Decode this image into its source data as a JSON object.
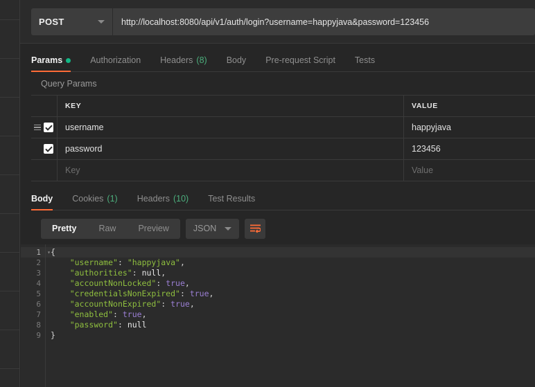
{
  "request": {
    "method": "POST",
    "method_caret_icon": "chevron-down-icon",
    "url": "http://localhost:8080/api/v1/auth/login?username=happyjava&password=123456",
    "tabs": [
      {
        "label": "Params",
        "active": true,
        "badge_dot": true
      },
      {
        "label": "Authorization",
        "active": false
      },
      {
        "label": "Headers",
        "active": false,
        "count": "(8)"
      },
      {
        "label": "Body",
        "active": false
      },
      {
        "label": "Pre-request Script",
        "active": false
      },
      {
        "label": "Tests",
        "active": false
      }
    ]
  },
  "params": {
    "section_label": "Query Params",
    "columns": {
      "key": "KEY",
      "value": "VALUE"
    },
    "rows": [
      {
        "checked": true,
        "drag_handle": true,
        "key": "username",
        "value": "happyjava"
      },
      {
        "checked": true,
        "drag_handle": false,
        "key": "password",
        "value": "123456"
      }
    ],
    "placeholder_row": {
      "key": "Key",
      "value": "Value"
    }
  },
  "response": {
    "tabs": [
      {
        "label": "Body",
        "active": true
      },
      {
        "label": "Cookies",
        "active": false,
        "count": "(1)"
      },
      {
        "label": "Headers",
        "active": false,
        "count": "(10)"
      },
      {
        "label": "Test Results",
        "active": false
      }
    ],
    "view_modes": [
      {
        "label": "Pretty",
        "active": true
      },
      {
        "label": "Raw",
        "active": false
      },
      {
        "label": "Preview",
        "active": false
      }
    ],
    "format": "JSON",
    "format_caret_icon": "chevron-down-icon",
    "wrap_icon": "word-wrap-icon",
    "body_lines": [
      {
        "n": "1",
        "active": true,
        "folded": true,
        "tokens": [
          {
            "t": "{",
            "c": "p"
          }
        ]
      },
      {
        "n": "2",
        "tokens": [
          {
            "t": "    ",
            "c": "p"
          },
          {
            "t": "\"username\"",
            "c": "k"
          },
          {
            "t": ": ",
            "c": "p"
          },
          {
            "t": "\"happyjava\"",
            "c": "s"
          },
          {
            "t": ",",
            "c": "p"
          }
        ]
      },
      {
        "n": "3",
        "tokens": [
          {
            "t": "    ",
            "c": "p"
          },
          {
            "t": "\"authorities\"",
            "c": "k"
          },
          {
            "t": ": ",
            "c": "p"
          },
          {
            "t": "null",
            "c": "n"
          },
          {
            "t": ",",
            "c": "p"
          }
        ]
      },
      {
        "n": "4",
        "tokens": [
          {
            "t": "    ",
            "c": "p"
          },
          {
            "t": "\"accountNonLocked\"",
            "c": "k"
          },
          {
            "t": ": ",
            "c": "p"
          },
          {
            "t": "true",
            "c": "b"
          },
          {
            "t": ",",
            "c": "p"
          }
        ]
      },
      {
        "n": "5",
        "tokens": [
          {
            "t": "    ",
            "c": "p"
          },
          {
            "t": "\"credentialsNonExpired\"",
            "c": "k"
          },
          {
            "t": ": ",
            "c": "p"
          },
          {
            "t": "true",
            "c": "b"
          },
          {
            "t": ",",
            "c": "p"
          }
        ]
      },
      {
        "n": "6",
        "tokens": [
          {
            "t": "    ",
            "c": "p"
          },
          {
            "t": "\"accountNonExpired\"",
            "c": "k"
          },
          {
            "t": ": ",
            "c": "p"
          },
          {
            "t": "true",
            "c": "b"
          },
          {
            "t": ",",
            "c": "p"
          }
        ]
      },
      {
        "n": "7",
        "tokens": [
          {
            "t": "    ",
            "c": "p"
          },
          {
            "t": "\"enabled\"",
            "c": "k"
          },
          {
            "t": ": ",
            "c": "p"
          },
          {
            "t": "true",
            "c": "b"
          },
          {
            "t": ",",
            "c": "p"
          }
        ]
      },
      {
        "n": "8",
        "tokens": [
          {
            "t": "    ",
            "c": "p"
          },
          {
            "t": "\"password\"",
            "c": "k"
          },
          {
            "t": ": ",
            "c": "p"
          },
          {
            "t": "null",
            "c": "n"
          }
        ]
      },
      {
        "n": "9",
        "tokens": [
          {
            "t": "}",
            "c": "p"
          }
        ]
      }
    ]
  },
  "sidebar": {
    "divider_positions": [
      28,
      84,
      140,
      196,
      252,
      308,
      364,
      420,
      476,
      532
    ]
  },
  "colors": {
    "accent": "#ff6c37",
    "badge_green": "#12b886",
    "count_green": "#4caf7d",
    "bg": "#262626",
    "panel": "#2b2b2b",
    "control": "#3a3a3a"
  }
}
